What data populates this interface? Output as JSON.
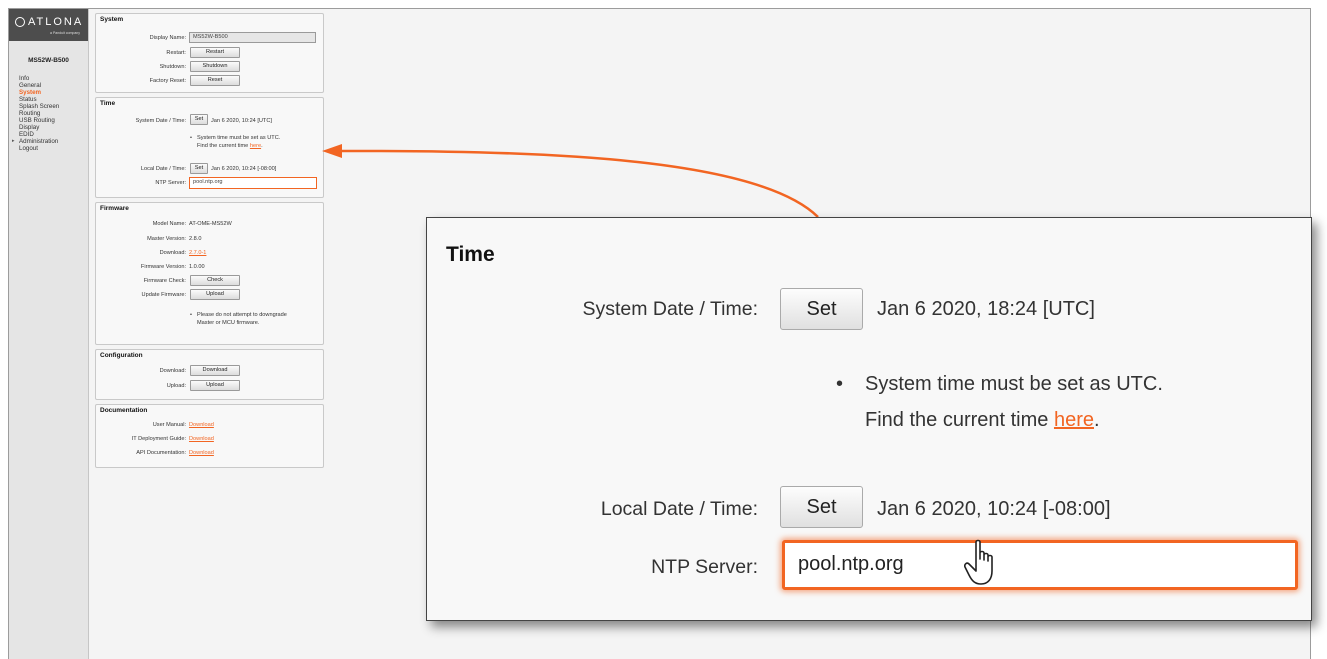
{
  "brand": {
    "name": "ATLONA",
    "tagline": "a Panduit company"
  },
  "sidebar": {
    "device_name": "MS52W-B500",
    "items": [
      {
        "label": "Info"
      },
      {
        "label": "General"
      },
      {
        "label": "System"
      },
      {
        "label": "Status"
      },
      {
        "label": "Splash Screen"
      },
      {
        "label": "Routing"
      },
      {
        "label": "USB Routing"
      },
      {
        "label": "Display"
      },
      {
        "label": "EDID"
      },
      {
        "label": "Administration"
      },
      {
        "label": "Logout"
      }
    ]
  },
  "system": {
    "title": "System",
    "display_name_label": "Display Name:",
    "display_name_value": "MS52W-B500",
    "restart_label": "Restart:",
    "restart_button": "Restart",
    "shutdown_label": "Shutdown:",
    "shutdown_button": "Shutdown",
    "factory_reset_label": "Factory Reset:",
    "reset_button": "Reset"
  },
  "time": {
    "title": "Time",
    "system_label": "System Date / Time:",
    "set_button": "Set",
    "system_value": "Jan 6 2020, 10:24 [UTC]",
    "note_line1_a": "System time must be set as ",
    "note_line1_b": "UTC",
    "note_line1_c": ".",
    "note_line2_a": "Find the current time ",
    "note_link": "here",
    "note_line2_c": ".",
    "local_label": "Local Date / Time:",
    "local_value": "Jan 6 2020, 10:24 [-08:00]",
    "ntp_label": "NTP Server:",
    "ntp_value": "pool.ntp.org"
  },
  "firmware": {
    "title": "Firmware",
    "model_label": "Model Name:",
    "model_value": "AT-OME-MS52W",
    "master_label": "Master Version:",
    "master_value": "2.8.0",
    "download_label": "Download:",
    "download_value": "2.7.0-1",
    "fw_version_label": "Firmware Version:",
    "fw_version_value": "1.0.00",
    "fw_check_label": "Firmware Check:",
    "check_button": "Check",
    "update_label": "Update Firmware:",
    "upload_button": "Upload",
    "note_line1": "Please do not attempt to downgrade",
    "note_line2": "Master or MCU firmware."
  },
  "configuration": {
    "title": "Configuration",
    "download_label": "Download:",
    "download_button": "Download",
    "upload_label": "Upload:",
    "upload_button": "Upload"
  },
  "documentation": {
    "title": "Documentation",
    "user_manual_label": "User Manual:",
    "it_guide_label": "IT Deployment Guide:",
    "api_doc_label": "API Documentation:",
    "download_link": "Download"
  },
  "zoom": {
    "title": "Time",
    "system_label": "System Date / Time:",
    "set_button": "Set",
    "system_value": "Jan 6 2020, 18:24 [UTC]",
    "note_line1_a": "System time must be set as ",
    "note_line1_b": "UTC",
    "note_line1_c": ".",
    "note_line2_a": "Find the current time ",
    "note_link": "here",
    "note_line2_c": ".",
    "local_label": "Local Date / Time:",
    "local_value": "Jan 6 2020, 10:24 [-08:00]",
    "ntp_label": "NTP Server:",
    "ntp_value": "pool.ntp.org"
  },
  "colors": {
    "accent": "#f26522",
    "sidebar_bg": "#e5e5e5",
    "logo_bg": "#4d4d4d",
    "panel_bg": "#f8f8f8"
  },
  "icons": {
    "logo": "atlona-logo-icon",
    "cursor": "hand-pointer-icon",
    "arrow": "callout-arrow-icon",
    "caret": "caret-right-icon"
  }
}
